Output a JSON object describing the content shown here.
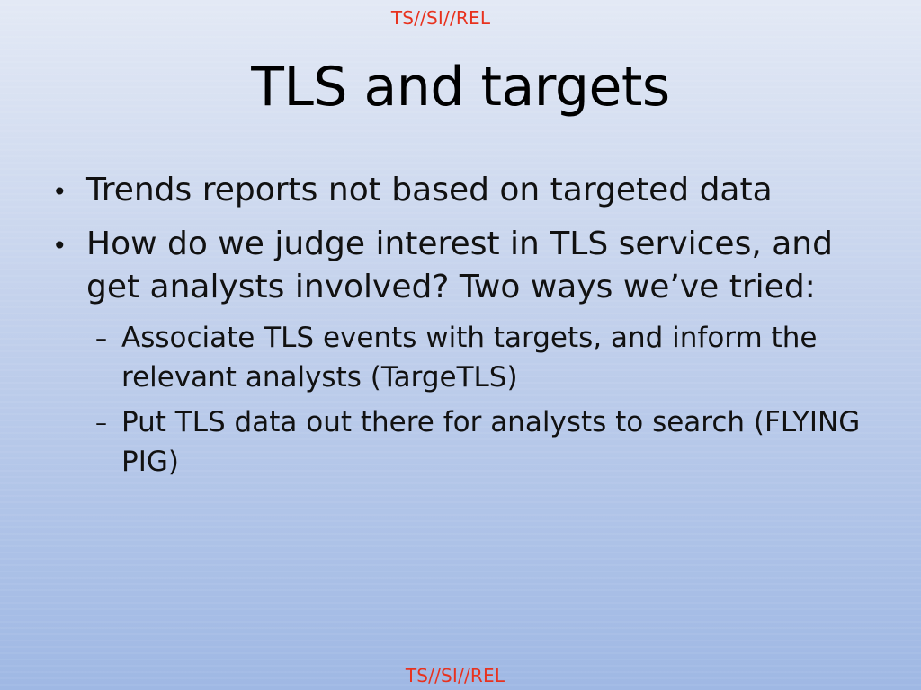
{
  "classification": {
    "top": "TS//SI//REL",
    "bottom": "TS//SI//REL"
  },
  "slide": {
    "title": "TLS and targets",
    "bullets": [
      {
        "marker": "•",
        "text": "Trends reports not based on targeted data"
      },
      {
        "marker": "•",
        "text": "How do we judge interest in TLS services, and get analysts involved?  Two ways we’ve tried:",
        "subbullets": [
          {
            "marker": "–",
            "text": "Associate TLS events with targets, and inform the relevant analysts (TargeTLS)"
          },
          {
            "marker": "–",
            "text": "Put TLS data out there for analysts to search (FLYING PIG)"
          }
        ]
      }
    ]
  },
  "colors": {
    "classification": "#e8321e",
    "title": "#000000",
    "body_text": "#111111",
    "background_top": "#e3e9f5",
    "background_bottom": "#9fb8e4"
  }
}
